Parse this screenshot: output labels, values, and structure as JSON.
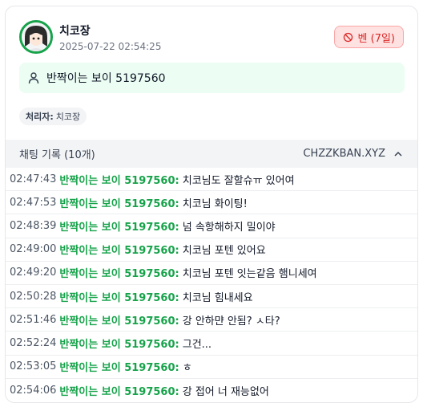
{
  "header": {
    "name": "치코장",
    "datetime": "2025-07-22 02:54:25",
    "ban_label": "벤 (7일)"
  },
  "target_user": {
    "label": "반짝이는 보이 5197560"
  },
  "handler": {
    "prefix": "처리자:",
    "name": "치코장"
  },
  "chat": {
    "title": "채팅 기록 (10개)",
    "channel": "CHZZKBAN.XYZ",
    "messages": [
      {
        "time": "02:47:43",
        "user": "반짝이는 보이 5197560:",
        "text": "치코님도 잘할슈ㅠ 있어여"
      },
      {
        "time": "02:47:53",
        "user": "반짝이는 보이 5197560:",
        "text": "치코님 화이팅!"
      },
      {
        "time": "02:48:39",
        "user": "반짝이는 보이 5197560:",
        "text": "넘 속항해하지 밀이야"
      },
      {
        "time": "02:49:00",
        "user": "반짝이는 보이 5197560:",
        "text": "치코님 포텐 있어요"
      },
      {
        "time": "02:49:20",
        "user": "반짝이는 보이 5197560:",
        "text": "치코님 포텐 잇는같음 햄니세여"
      },
      {
        "time": "02:50:28",
        "user": "반짝이는 보이 5197560:",
        "text": "치코님 힘내세요"
      },
      {
        "time": "02:51:46",
        "user": "반짝이는 보이 5197560:",
        "text": "강 안하먄 안됨? ㅅ타?"
      },
      {
        "time": "02:52:24",
        "user": "반짝이는 보이 5197560:",
        "text": "그건..."
      },
      {
        "time": "02:53:05",
        "user": "반짝이는 보이 5197560:",
        "text": "ㅎ"
      },
      {
        "time": "02:54:06",
        "user": "반짝이는 보이 5197560:",
        "text": "강 접어 너 재능없어"
      }
    ]
  },
  "colors": {
    "accent_green": "#16a34a",
    "ban_red": "#dc2626",
    "user_box_bg": "#ecfdf3"
  }
}
